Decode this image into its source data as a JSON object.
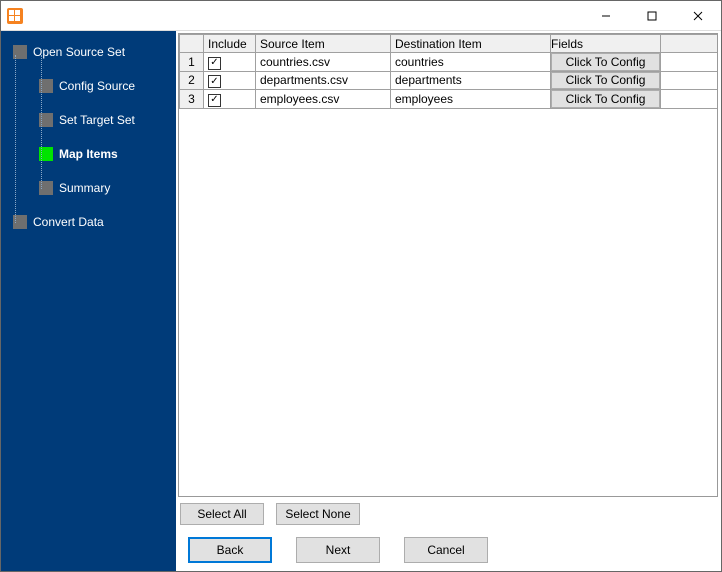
{
  "window": {
    "title": ""
  },
  "sidebar": {
    "items": [
      {
        "label": "Open Source Set",
        "level": 1,
        "active": false,
        "bold": false
      },
      {
        "label": "Config Source",
        "level": 2,
        "active": false,
        "bold": false
      },
      {
        "label": "Set Target Set",
        "level": 2,
        "active": false,
        "bold": false
      },
      {
        "label": "Map Items",
        "level": 2,
        "active": true,
        "bold": true
      },
      {
        "label": "Summary",
        "level": 2,
        "active": false,
        "bold": false
      },
      {
        "label": "Convert Data",
        "level": 1,
        "active": false,
        "bold": false
      }
    ]
  },
  "grid": {
    "headers": {
      "include": "Include",
      "source": "Source Item",
      "destination": "Destination Item",
      "fields": "Fields"
    },
    "rows": [
      {
        "num": "1",
        "include": true,
        "source": "countries.csv",
        "destination": "countries",
        "fields_btn": "Click To Config"
      },
      {
        "num": "2",
        "include": true,
        "source": "departments.csv",
        "destination": "departments",
        "fields_btn": "Click To Config"
      },
      {
        "num": "3",
        "include": true,
        "source": "employees.csv",
        "destination": "employees",
        "fields_btn": "Click To Config"
      }
    ]
  },
  "buttons": {
    "select_all": "Select All",
    "select_none": "Select None",
    "back": "Back",
    "next": "Next",
    "cancel": "Cancel"
  }
}
